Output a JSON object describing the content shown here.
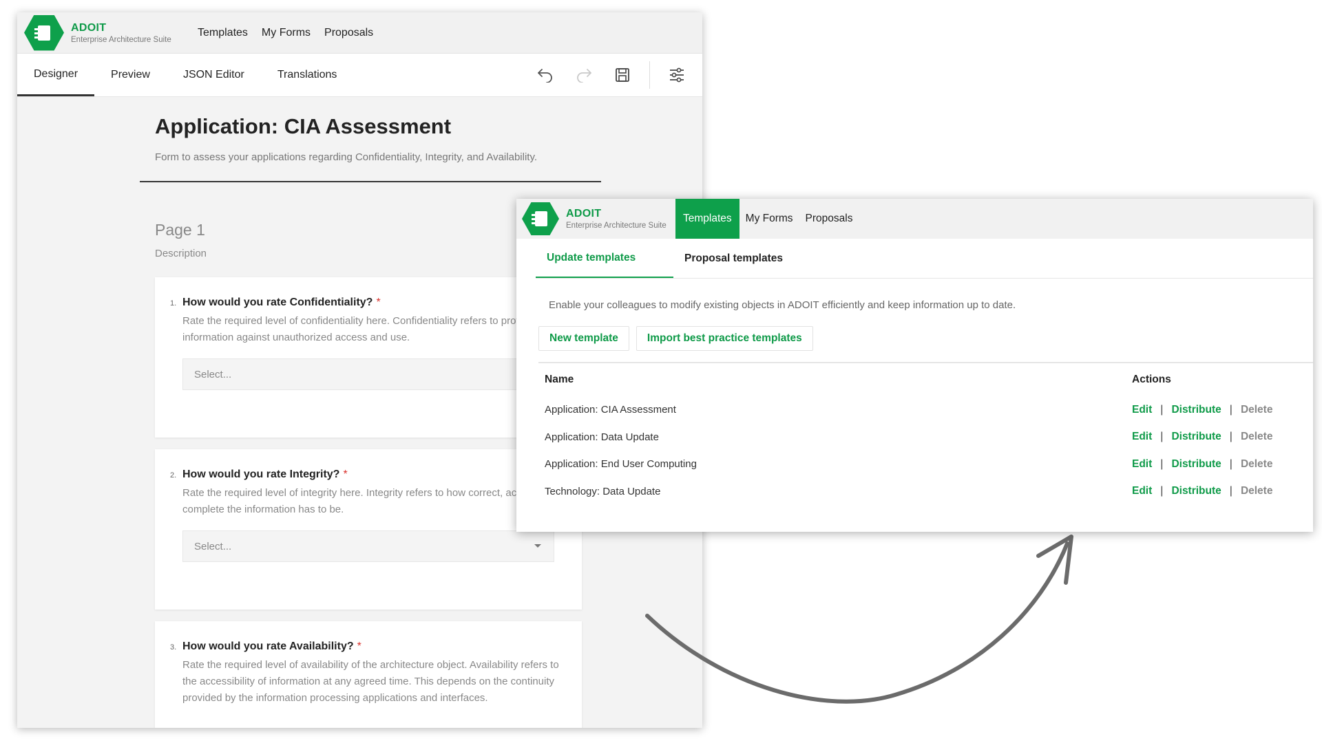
{
  "brand": {
    "name": "ADOIT",
    "subtitle": "Enterprise Architecture Suite",
    "color": "#0ea04b"
  },
  "designer": {
    "topnav": [
      "Templates",
      "My Forms",
      "Proposals"
    ],
    "tabs": [
      "Designer",
      "Preview",
      "JSON Editor",
      "Translations"
    ],
    "active_tab": "Designer",
    "toolbar_icons": [
      "undo-icon",
      "redo-icon",
      "save-icon",
      "settings-sliders-icon"
    ],
    "form": {
      "title": "Application: CIA Assessment",
      "description": "Form to assess your applications regarding Confidentiality, Integrity, and Availability.",
      "page_title": "Page 1",
      "page_description": "Description",
      "questions": [
        {
          "num": "1.",
          "label": "How would you rate Confidentiality?",
          "required": "*",
          "help": "Rate the required level of confidentiality here. Confidentiality refers to protecting information against unauthorized access and use.",
          "placeholder": "Select..."
        },
        {
          "num": "2.",
          "label": "How would you rate Integrity?",
          "required": "*",
          "help": "Rate the required level of integrity here. Integrity refers to how correct, accurate and complete the information has to be.",
          "placeholder": "Select..."
        },
        {
          "num": "3.",
          "label": "How would you rate Availability?",
          "required": "*",
          "help": "Rate the required level of availability of the architecture object. Availability refers to the accessibility of information at any agreed time. This depends on the continuity provided by the information processing applications and interfaces.",
          "placeholder": ""
        }
      ]
    }
  },
  "templates_window": {
    "nav": [
      "Templates",
      "My Forms",
      "Proposals"
    ],
    "active_nav": "Templates",
    "tabs": [
      "Update templates",
      "Proposal templates"
    ],
    "active_tab": "Update templates",
    "description": "Enable your colleagues to modify existing objects in ADOIT efficiently and keep information up to date.",
    "buttons": {
      "new": "New template",
      "import": "Import best practice templates"
    },
    "table": {
      "headers": {
        "name": "Name",
        "actions": "Actions"
      },
      "rows": [
        {
          "name": "Application: CIA Assessment"
        },
        {
          "name": "Application: Data Update"
        },
        {
          "name": "Application: End User Computing"
        },
        {
          "name": "Technology: Data Update"
        }
      ],
      "actions": {
        "edit": "Edit",
        "distribute": "Distribute",
        "delete": "Delete",
        "separator": "|"
      }
    }
  }
}
